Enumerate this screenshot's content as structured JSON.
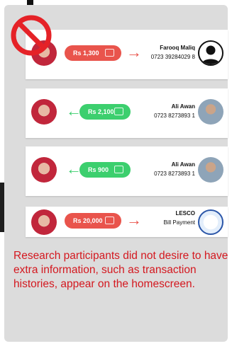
{
  "transactions": [
    {
      "direction": "sent",
      "amount": "Rs 1,300",
      "name": "Farooq Maliq",
      "number": "0723 39284029 8",
      "contact_icon": "person-outline-icon"
    },
    {
      "direction": "received",
      "amount": "Rs 2,100",
      "name": "Ali Awan",
      "number": "0723 8273893 1",
      "contact_icon": "contact-photo"
    },
    {
      "direction": "received",
      "amount": "Rs 900",
      "name": "Ali Awan",
      "number": "0723 8273893 1",
      "contact_icon": "contact-photo"
    },
    {
      "direction": "sent",
      "amount": "Rs 20,000",
      "name": "LESCO",
      "number": "Bill Payment",
      "contact_icon": "lesco-logo"
    }
  ],
  "arrows": {
    "sent": "→",
    "received": "←"
  },
  "caption": "Research participants did not desire to have extra information, such as transaction histories, appear on the homescreen.",
  "colors": {
    "sent": "#e9544c",
    "received": "#3ccf6e",
    "caption": "#d4181f",
    "prohibition": "#e52227"
  },
  "icons": {
    "prohibition": "prohibited-icon",
    "wallet": "wallet-icon"
  }
}
